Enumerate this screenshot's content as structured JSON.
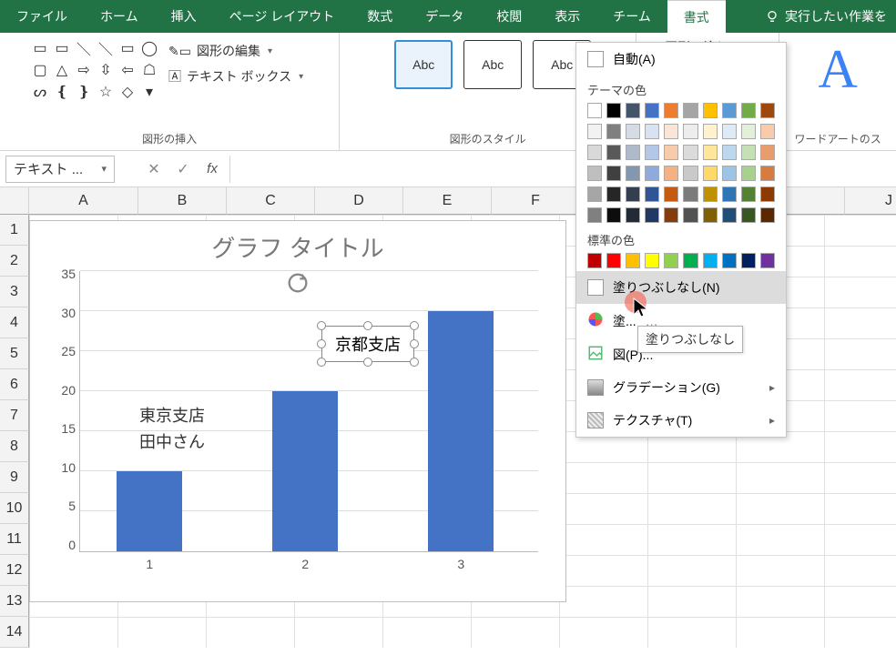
{
  "tabs": {
    "file": "ファイル",
    "home": "ホーム",
    "insert": "挿入",
    "layout": "ページ レイアウト",
    "formulas": "数式",
    "data": "データ",
    "review": "校閲",
    "view": "表示",
    "team": "チーム",
    "format": "書式"
  },
  "tell_me": "実行したい作業を",
  "ribbon": {
    "edit_shape": "図形の編集",
    "text_box": "テキスト ボックス",
    "shapes_group": "図形の挿入",
    "style_chip": "Abc",
    "styles_group": "図形のスタイル",
    "shape_fill": "図形の塗りつぶし",
    "wordart_group": "ワードアートのス"
  },
  "fbar": {
    "name": "テキスト ..."
  },
  "cols": [
    "A",
    "B",
    "C",
    "D",
    "E",
    "F",
    "",
    "",
    "",
    "J"
  ],
  "rows": [
    "1",
    "2",
    "3",
    "4",
    "5",
    "6",
    "7",
    "8",
    "9",
    "10",
    "11",
    "12",
    "13",
    "14"
  ],
  "fill_panel": {
    "auto": "自動(A)",
    "theme": "テーマの色",
    "standard": "標準の色",
    "no_fill": "塗りつぶしなし(N)",
    "more": "塗...",
    "picture": "図(P)...",
    "gradient": "グラデーション(G)",
    "texture": "テクスチャ(T)",
    "tooltip": "塗りつぶしなし",
    "theme_grid": [
      [
        "#ffffff",
        "#000000",
        "#44546A",
        "#4472C4",
        "#ED7D31",
        "#A5A5A5",
        "#FFC000",
        "#5B9BD5",
        "#70AD47",
        "#9E480E"
      ],
      [
        "#F2F2F2",
        "#7F7F7F",
        "#D6DCE5",
        "#D9E2F3",
        "#FBE5D6",
        "#EDEDED",
        "#FFF2CC",
        "#DEEBF7",
        "#E2F0D9",
        "#F7CBAC"
      ],
      [
        "#D9D9D9",
        "#595959",
        "#AEB9CA",
        "#B4C7E7",
        "#F8CBAD",
        "#DBDBDB",
        "#FFE699",
        "#BDD7EE",
        "#C5E0B4",
        "#E89D6E"
      ],
      [
        "#BFBFBF",
        "#404040",
        "#8497B0",
        "#8FAADC",
        "#F4B183",
        "#C9C9C9",
        "#FFD966",
        "#9DC3E6",
        "#A9D18E",
        "#D87B3E"
      ],
      [
        "#A6A6A6",
        "#262626",
        "#333F50",
        "#2F5597",
        "#C55A11",
        "#7B7B7B",
        "#BF9000",
        "#2E75B6",
        "#548235",
        "#8B3A00"
      ],
      [
        "#808080",
        "#0D0D0D",
        "#222A35",
        "#1F3864",
        "#843C0C",
        "#525252",
        "#806000",
        "#1F4E79",
        "#385723",
        "#5C2600"
      ]
    ],
    "standard_row": [
      "#C00000",
      "#FF0000",
      "#FFC000",
      "#FFFF00",
      "#92D050",
      "#00B050",
      "#00B0F0",
      "#0070C0",
      "#002060",
      "#7030A0"
    ]
  },
  "chart_data": {
    "type": "bar",
    "title": "グラフ タイトル",
    "categories": [
      "1",
      "2",
      "3"
    ],
    "values": [
      10,
      20,
      30
    ],
    "xlabel": "",
    "ylabel": "",
    "ylim": [
      0,
      35
    ],
    "ytick": 5,
    "labels": {
      "bar1": "東京支店\n田中さん",
      "bar2": "京都支店"
    }
  }
}
